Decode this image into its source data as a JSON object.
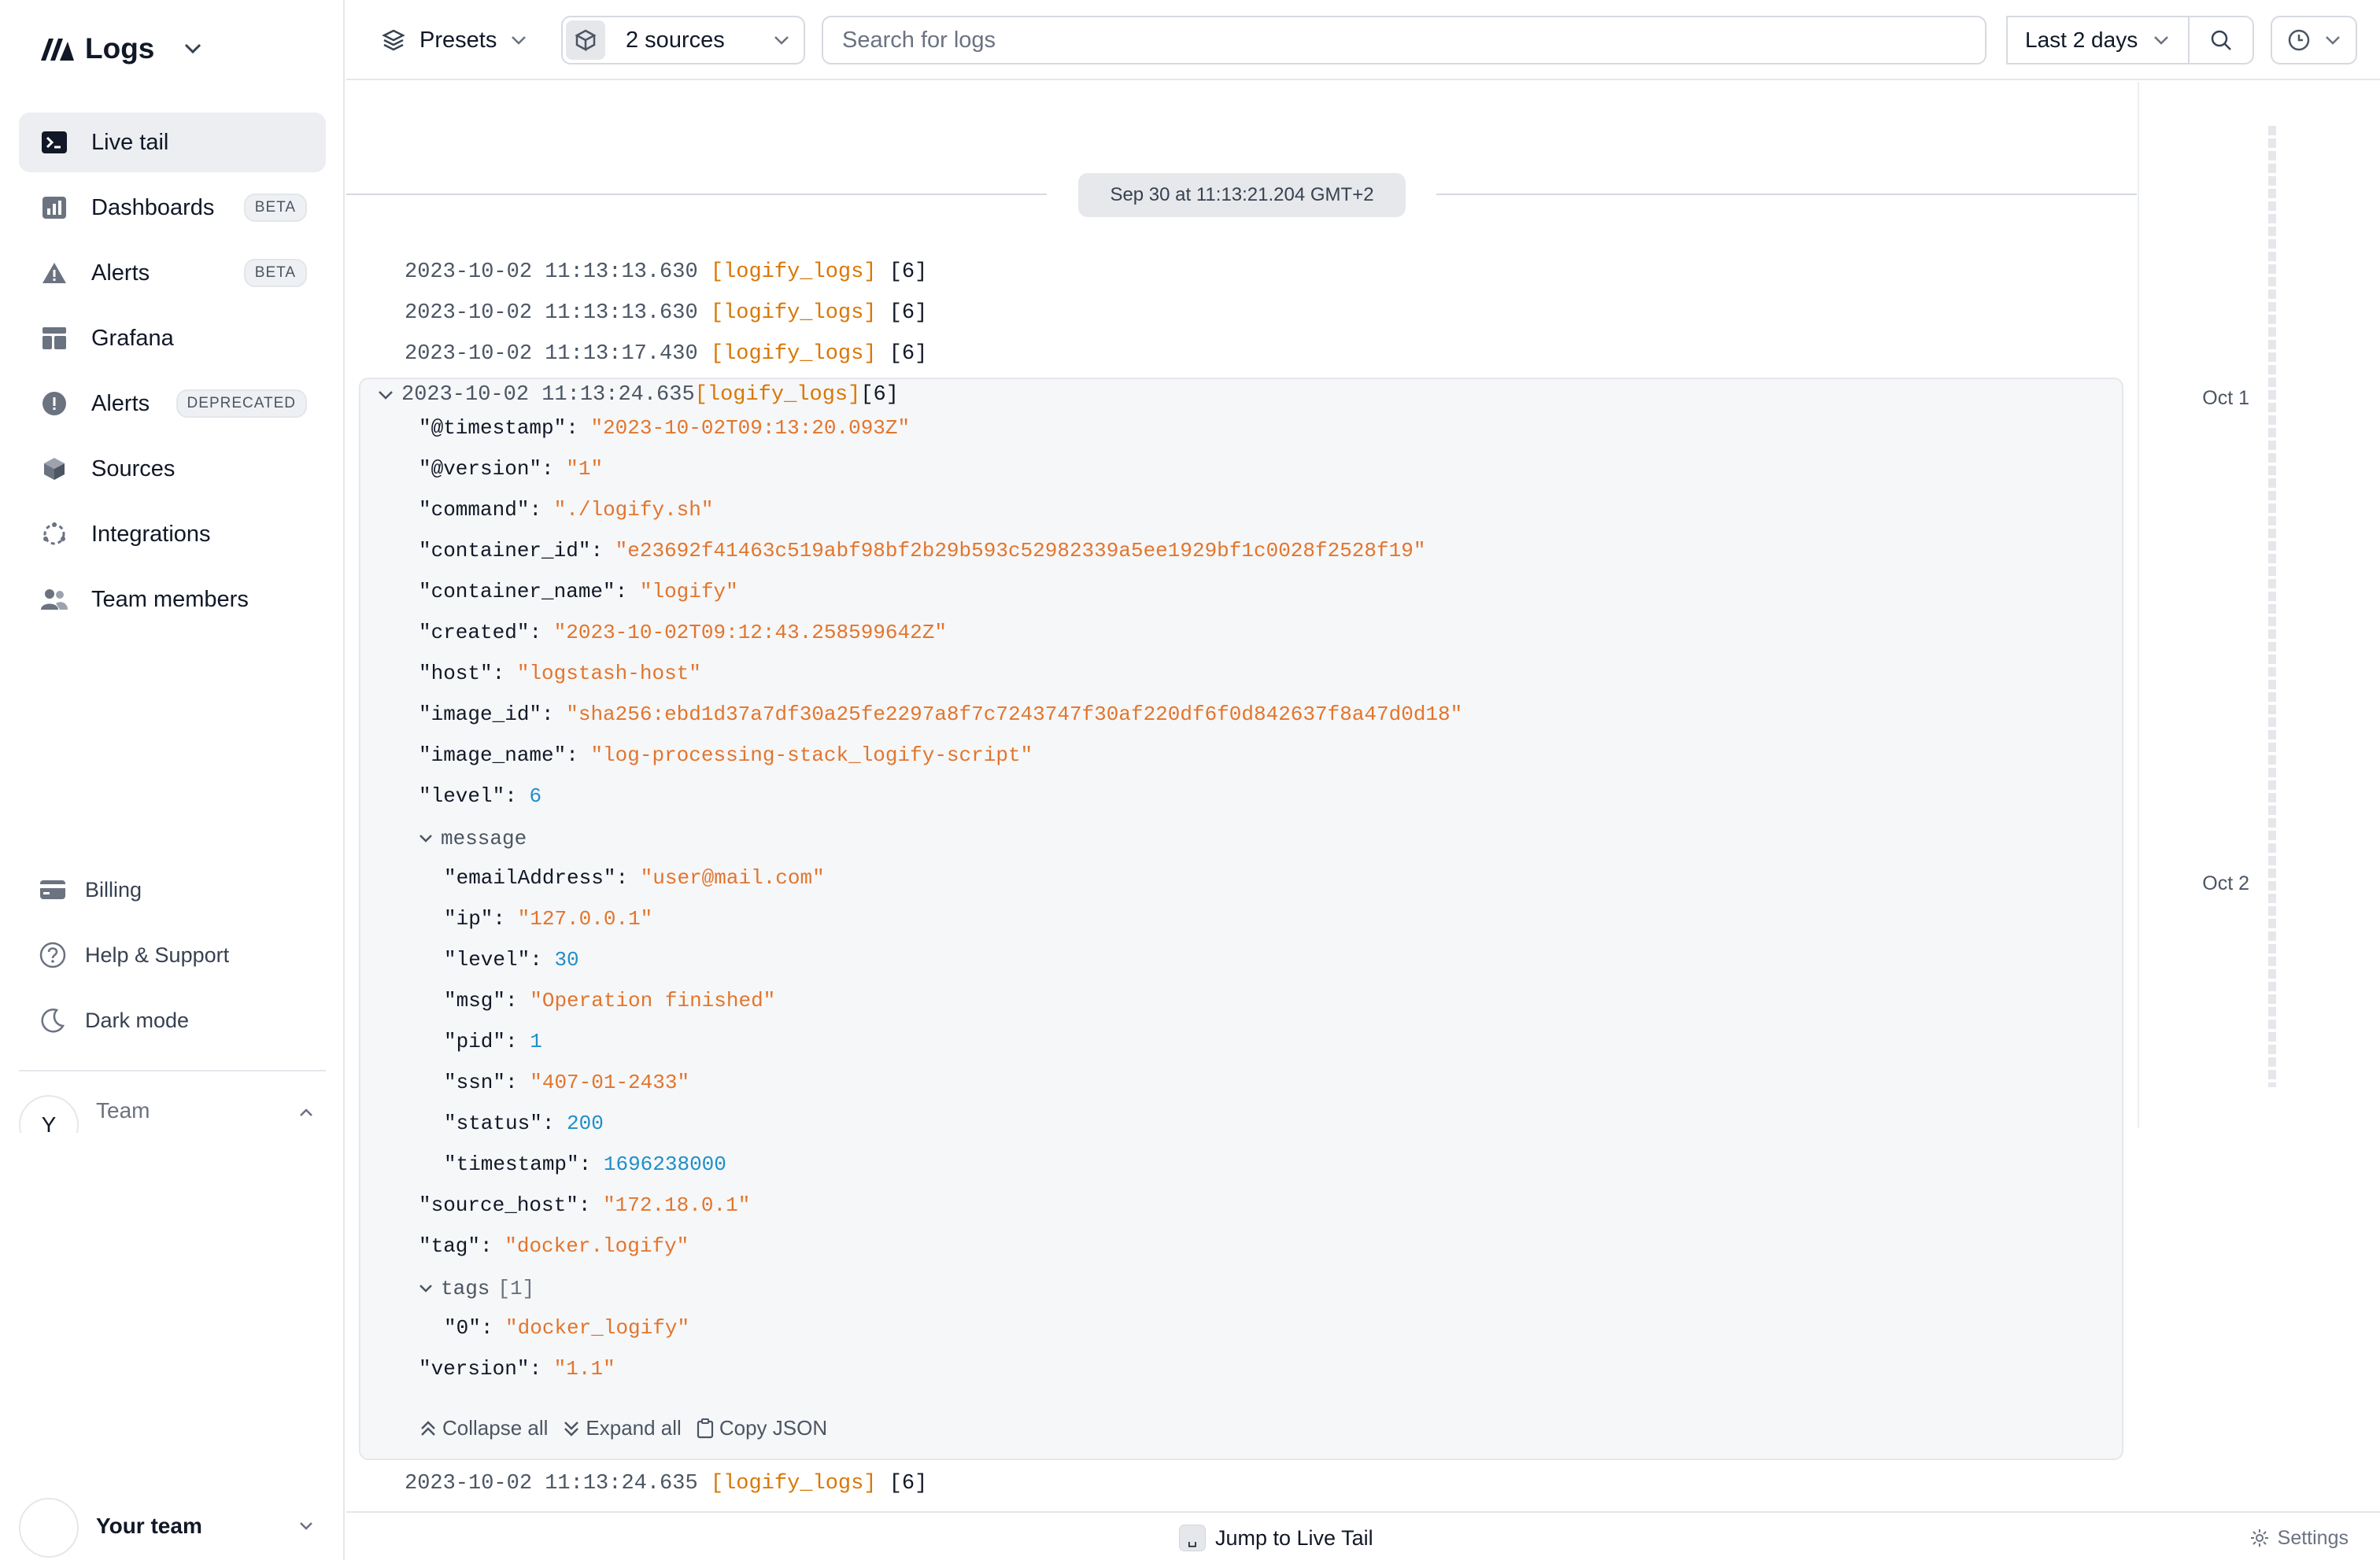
{
  "brand": {
    "name": "Logs"
  },
  "nav": [
    {
      "label": "Live tail",
      "badge": "",
      "icon": "terminal-icon"
    },
    {
      "label": "Dashboards",
      "badge": "BETA",
      "icon": "bar-chart-icon"
    },
    {
      "label": "Alerts",
      "badge": "BETA",
      "icon": "warning-triangle-icon"
    },
    {
      "label": "Grafana",
      "badge": "",
      "icon": "grafana-layout-icon"
    },
    {
      "label": "Alerts",
      "badge": "DEPRECATED",
      "icon": "alert-circle-icon"
    },
    {
      "label": "Sources",
      "badge": "",
      "icon": "cube-icon"
    },
    {
      "label": "Integrations",
      "badge": "",
      "icon": "integrations-icon"
    },
    {
      "label": "Team members",
      "badge": "",
      "icon": "users-icon"
    }
  ],
  "bottom_nav": [
    {
      "label": "Billing",
      "icon": "credit-card-icon"
    },
    {
      "label": "Help & Support",
      "icon": "help-circle-icon"
    },
    {
      "label": "Dark mode",
      "icon": "moon-icon"
    }
  ],
  "team": {
    "label": "Team",
    "avatar": "Y"
  },
  "your_team": {
    "label": "Your team"
  },
  "topbar": {
    "presets_label": "Presets",
    "sources_label": "2 sources",
    "search_placeholder": "Search for logs",
    "range_label": "Last 2 days"
  },
  "timeline": {
    "labels": [
      "Oct 1",
      "Oct 2"
    ]
  },
  "logs": {
    "date_separator": "Sep 30 at 11:13:21.204 GMT+2",
    "lines_before": [
      {
        "ts": "2023-10-02 11:13:13.630",
        "source": "[logify_logs]",
        "level": "[6]"
      },
      {
        "ts": "2023-10-02 11:13:13.630",
        "source": "[logify_logs]",
        "level": "[6]"
      },
      {
        "ts": "2023-10-02 11:13:17.430",
        "source": "[logify_logs]",
        "level": "[6]"
      }
    ],
    "expanded": {
      "ts": "2023-10-02 11:13:24.635",
      "source": "[logify_logs]",
      "level": "[6]",
      "fields": [
        {
          "key": "\"@timestamp\"",
          "value": "\"2023-10-02T09:13:20.093Z\"",
          "kind": "s"
        },
        {
          "key": "\"@version\"",
          "value": "\"1\"",
          "kind": "s"
        },
        {
          "key": "\"command\"",
          "value": "\"./logify.sh\"",
          "kind": "s"
        },
        {
          "key": "\"container_id\"",
          "value": "\"e23692f41463c519abf98bf2b29b593c52982339a5ee1929bf1c0028f2528f19\"",
          "kind": "s"
        },
        {
          "key": "\"container_name\"",
          "value": "\"logify\"",
          "kind": "s"
        },
        {
          "key": "\"created\"",
          "value": "\"2023-10-02T09:12:43.258599642Z\"",
          "kind": "s"
        },
        {
          "key": "\"host\"",
          "value": "\"logstash-host\"",
          "kind": "s"
        },
        {
          "key": "\"image_id\"",
          "value": "\"sha256:ebd1d37a7df30a25fe2297a8f7c7243747f30af220df6f0d842637f8a47d0d18\"",
          "kind": "s"
        },
        {
          "key": "\"image_name\"",
          "value": "\"log-processing-stack_logify-script\"",
          "kind": "s"
        },
        {
          "key": "\"level\"",
          "value": "6",
          "kind": "n"
        }
      ],
      "message_group": {
        "label": "message"
      },
      "message_fields": [
        {
          "key": "\"emailAddress\"",
          "value": "\"user@mail.com\"",
          "kind": "s"
        },
        {
          "key": "\"ip\"",
          "value": "\"127.0.0.1\"",
          "kind": "s"
        },
        {
          "key": "\"level\"",
          "value": "30",
          "kind": "n"
        },
        {
          "key": "\"msg\"",
          "value": "\"Operation finished\"",
          "kind": "s"
        },
        {
          "key": "\"pid\"",
          "value": "1",
          "kind": "n"
        },
        {
          "key": "\"ssn\"",
          "value": "\"407-01-2433\"",
          "kind": "s"
        },
        {
          "key": "\"status\"",
          "value": "200",
          "kind": "n"
        },
        {
          "key": "\"timestamp\"",
          "value": "1696238000",
          "kind": "n"
        }
      ],
      "after_fields": [
        {
          "key": "\"source_host\"",
          "value": "\"172.18.0.1\"",
          "kind": "s"
        },
        {
          "key": "\"tag\"",
          "value": "\"docker.logify\"",
          "kind": "s"
        }
      ],
      "tags_group": {
        "label": "tags",
        "count": "[1]"
      },
      "tags_fields": [
        {
          "key": "\"0\"",
          "value": "\"docker_logify\"",
          "kind": "s"
        }
      ],
      "final_fields": [
        {
          "key": "\"version\"",
          "value": "\"1.1\"",
          "kind": "s"
        }
      ],
      "actions": {
        "collapse": "Collapse all",
        "expand": "Expand all",
        "copy": "Copy JSON"
      }
    },
    "lines_after": [
      {
        "ts": "2023-10-02 11:13:24.635",
        "source": "[logify_logs]",
        "level": "[6]"
      }
    ]
  },
  "footer": {
    "jump_label": "Jump to Live Tail",
    "jump_key": "␣",
    "settings_label": "Settings"
  },
  "colors": {
    "string": "#e2752d",
    "number": "#1f8fc9",
    "source": "#d97706",
    "active_bg": "#eceef1"
  }
}
